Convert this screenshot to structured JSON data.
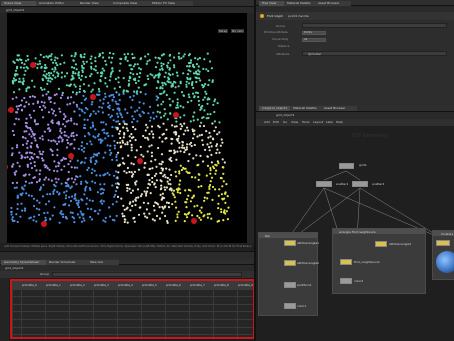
{
  "viewport": {
    "tabs": [
      "Scene View",
      "Animation Editor",
      "Render View",
      "Composite View",
      "Motion FX View"
    ],
    "title": "grid_object1",
    "persp_label": "Persp",
    "cam_label": "No cam",
    "status": "Left mouse tumbles. Middle pans. Right dollies. Ctrl+Alt+Left box-zooms. Ctrl+Right zooms. Spacebar Ctrl+Left tilts. Hotel-L for alternate tumble, dolly, and zoom.    M or Alt+M for First Person"
  },
  "spreadsheet": {
    "tabs": [
      "Geometry Spreadsheet",
      "Render Scheduler",
      "Take List"
    ],
    "path": "grid_object1",
    "group_label": "Group",
    "columns": [
      "",
      "primdata_0",
      "primdata_1",
      "primdata_2",
      "primdata_3",
      "primdata_4",
      "primdata_5",
      "primdata_6",
      "primdata_7",
      "primdata_8",
      "primdata_9"
    ]
  },
  "params": {
    "tabs": [
      "Tree View",
      "Material Palette",
      "Asset Browser"
    ],
    "node_label": "Font Glyph",
    "node_name": "point1 handle",
    "rows": [
      {
        "label": "Group",
        "value": ""
      },
      {
        "label": "Primitive Attribute",
        "value": "Points"
      },
      {
        "label": "Connectivity",
        "value": "All"
      },
      {
        "label": "Distance",
        "value": ""
      },
      {
        "label": "Attribute",
        "value": "@cluster"
      }
    ]
  },
  "network": {
    "tabs": [
      "/obj/grid_object1",
      "Material Palette",
      "Asset Browser"
    ],
    "menu": [
      "Add",
      "Edit",
      "Go",
      "View",
      "Tools",
      "Layout",
      "Labs",
      "Help"
    ],
    "path": "grid_object1",
    "watermark": "SOP Geometry",
    "nodes": {
      "grid1": "grid1",
      "scatter1": "scatter1",
      "scatter2": "scatter2",
      "attribwrangle1": "attribwrangle1",
      "attribwrangle2": "attribwrangle2",
      "partition1": "partition1",
      "color1": "color1",
      "attribwrangle3": "attribwrangle3",
      "find_neighbours1": "find_neighbours1",
      "color2": "color2",
      "attribwrangle4": "attribwrangle4"
    },
    "boxes": {
      "left": "Rip",
      "mid": "wrangle find neighbours",
      "right": "Clusters"
    }
  },
  "colors": {
    "accent": "#e8a32b",
    "selected_red": "#c8161b",
    "cluster_teal": "#5fd6b0",
    "cluster_yellow": "#e6e84a",
    "cluster_purple": "#a98ee6",
    "cluster_blue": "#4a8fe0",
    "cluster_white": "#e8e2c8"
  }
}
